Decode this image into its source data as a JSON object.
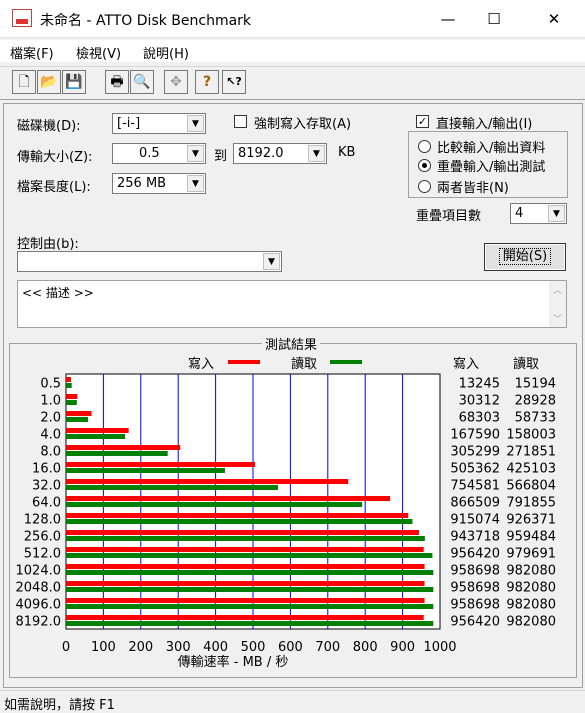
{
  "window": {
    "title": "未命名 - ATTO Disk Benchmark",
    "minimize_glyph": "—",
    "maximize_glyph": "☐",
    "close_glyph": "✕"
  },
  "menu": [
    {
      "label": "檔案(F)"
    },
    {
      "label": "檢視(V)"
    },
    {
      "label": "說明(H)"
    }
  ],
  "toolbar": {
    "buttons": [
      {
        "name": "new-document-icon",
        "glyph": "🗋"
      },
      {
        "name": "open-folder-icon",
        "glyph": "📂"
      },
      {
        "name": "save-icon",
        "glyph": "💾"
      },
      {
        "name": "print-icon",
        "glyph": "🖶"
      },
      {
        "name": "print-preview-icon",
        "glyph": "🔍"
      },
      {
        "name": "move-icon",
        "glyph": "✥"
      },
      {
        "name": "help-icon",
        "glyph": "?"
      },
      {
        "name": "context-help-icon",
        "glyph": "↖?"
      }
    ]
  },
  "settings": {
    "drive_label": "磁碟機(D):",
    "drive_value": "[-i-]",
    "force_write_label": "強制寫入存取(A)",
    "direct_io_label": "直接輸入/輸出(I)",
    "direct_io_checked": true,
    "transfer_size_label": "傳輸大小(Z):",
    "transfer_from": "0.5",
    "to_label": "到",
    "transfer_to": "8192.0",
    "unit_label": "KB",
    "file_length_label": "檔案長度(L):",
    "file_length_value": "256 MB",
    "radio_compare": "比較輸入/輸出資料",
    "radio_overlap": "重疊輸入/輸出測試",
    "radio_neither": "兩者皆非(N)",
    "queue_depth_label": "重疊項目數",
    "queue_depth_value": "4",
    "controlled_by_label": "控制由(b):",
    "controlled_by_value": "",
    "start_button": "開始(S)",
    "description": "<< 描述 >>"
  },
  "results": {
    "title": "測試結果",
    "write_legend": "寫入",
    "read_legend": "讀取",
    "write_header": "寫入",
    "read_header": "讀取"
  },
  "chart_data": {
    "type": "bar",
    "orientation": "horizontal",
    "categories": [
      "0.5",
      "1.0",
      "2.0",
      "4.0",
      "8.0",
      "16.0",
      "32.0",
      "64.0",
      "128.0",
      "256.0",
      "512.0",
      "1024.0",
      "2048.0",
      "4096.0",
      "8192.0"
    ],
    "series": [
      {
        "name": "寫入",
        "color": "#ff0000",
        "values": [
          13245,
          30312,
          68303,
          167590,
          305299,
          505362,
          754581,
          866509,
          915074,
          943718,
          956420,
          958698,
          958698,
          958698,
          956420
        ]
      },
      {
        "name": "讀取",
        "color": "#008000",
        "values": [
          15194,
          28928,
          58733,
          158003,
          271851,
          425103,
          566804,
          791855,
          926371,
          959484,
          979691,
          982080,
          982080,
          982080,
          982080
        ]
      }
    ],
    "xlabel": "傳輸速率 - MB / 秒",
    "xticks": [
      "0",
      "100",
      "200",
      "300",
      "400",
      "500",
      "600",
      "700",
      "800",
      "900",
      "1000"
    ],
    "xlim": [
      0,
      1000
    ],
    "grid": "vertical",
    "colors": {
      "grid": "#0000ff",
      "write": "#ff0000",
      "read": "#008000"
    }
  },
  "status": {
    "text": "如需說明，請按 F1"
  }
}
